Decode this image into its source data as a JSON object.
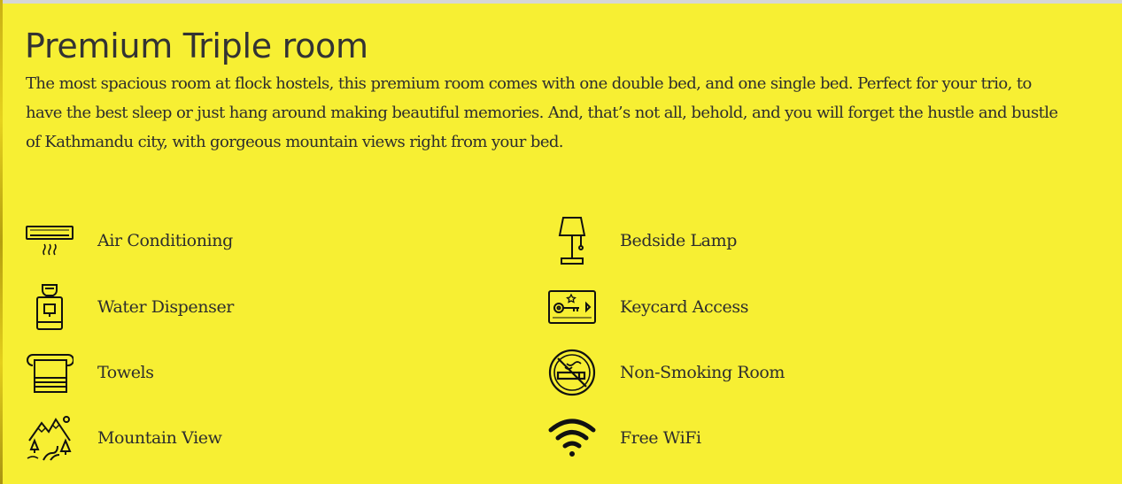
{
  "room": {
    "title": "Premium Triple room",
    "description": "The most spacious room at flock hostels, this premium room comes with one double bed, and one single bed. Perfect for your trio, to have the best sleep or just hang around making beautiful memories. And, that’s not all, behold, and you will forget the hustle and bustle of Kathmandu city, with gorgeous mountain views right from your bed."
  },
  "amenities": {
    "left": [
      {
        "label": "Air Conditioning",
        "icon": "air-conditioner-icon"
      },
      {
        "label": "Water Dispenser",
        "icon": "water-dispenser-icon"
      },
      {
        "label": "Towels",
        "icon": "towel-icon"
      },
      {
        "label": "Mountain View",
        "icon": "mountain-view-icon"
      }
    ],
    "right": [
      {
        "label": "Bedside Lamp",
        "icon": "lamp-icon"
      },
      {
        "label": "Keycard Access",
        "icon": "keycard-icon"
      },
      {
        "label": "Non-Smoking Room",
        "icon": "no-smoking-icon"
      },
      {
        "label": "Free WiFi",
        "icon": "wifi-icon"
      }
    ]
  },
  "colors": {
    "background": "#f7ef33",
    "text": "#2d2d2d",
    "icon": "#111111"
  }
}
